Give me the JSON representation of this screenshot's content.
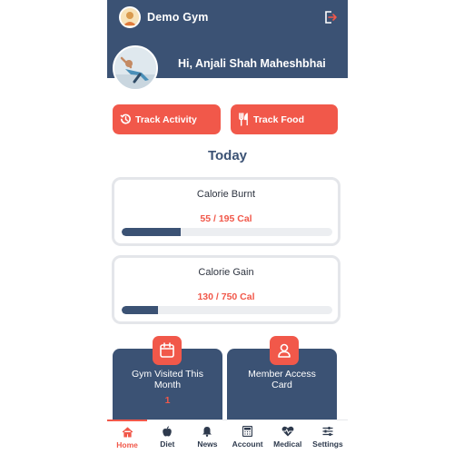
{
  "header": {
    "app_title": "Demo  Gym",
    "logo_icon": "gym-logo-avatar",
    "logout_icon": "logout-icon"
  },
  "greeting": {
    "text": "Hi, Anjali Shah Maheshbhai",
    "avatar_icon": "user-avatar"
  },
  "actions": {
    "track_activity": "Track Activity",
    "track_food": "Track Food"
  },
  "today_label": "Today",
  "calorie_burnt": {
    "title": "Calorie Burnt",
    "value_text": "55 / 195 Cal",
    "current": 55,
    "target": 195
  },
  "calorie_gain": {
    "title": "Calorie Gain",
    "value_text": "130 / 750 Cal",
    "current": 130,
    "target": 750
  },
  "tiles": {
    "gym_visited": {
      "label_line1": "Gym Visited This",
      "label_line2": "Month",
      "count": "1",
      "icon": "calendar-icon"
    },
    "member_card": {
      "label_line1": "Member Access",
      "label_line2": "Card",
      "icon": "user-card-icon"
    }
  },
  "bottom_nav": {
    "items": [
      {
        "label": "Home",
        "icon": "home-icon",
        "active": true
      },
      {
        "label": "Diet",
        "icon": "apple-icon",
        "active": false
      },
      {
        "label": "News",
        "icon": "bell-icon",
        "active": false
      },
      {
        "label": "Account",
        "icon": "calculator-icon",
        "active": false
      },
      {
        "label": "Medical",
        "icon": "heartbeat-icon",
        "active": false
      },
      {
        "label": "Settings",
        "icon": "sliders-icon",
        "active": false
      }
    ]
  },
  "colors": {
    "primary": "#3b5274",
    "accent": "#f1584a",
    "card_border": "#e4e6ea",
    "track": "#eceef1"
  }
}
